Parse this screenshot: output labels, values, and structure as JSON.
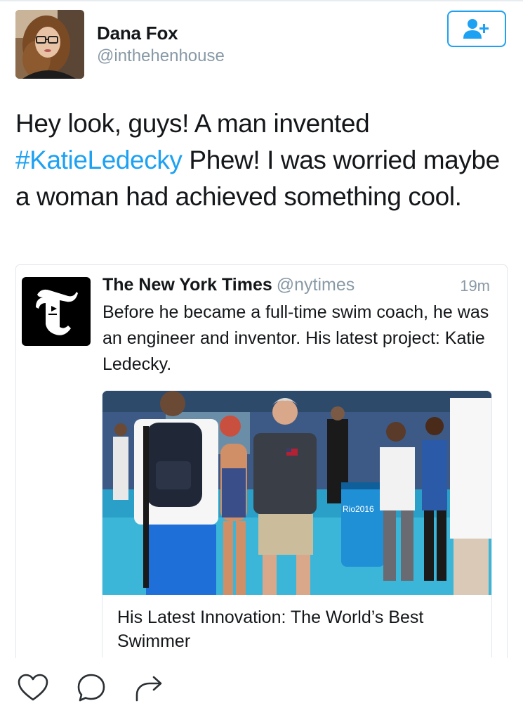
{
  "author": {
    "display_name": "Dana Fox",
    "handle": "@inthehenhouse",
    "avatar_icon": "profile-photo-woman-glasses"
  },
  "follow_button": {
    "icon": "follow-user-plus-icon",
    "accent_color": "#1da1f2"
  },
  "tweet": {
    "text_before": "Hey look, guys! A man invented ",
    "hashtag": "#KatieLedecky",
    "text_after": " Phew! I was worried maybe a woman had achieved something cool."
  },
  "quoted_tweet": {
    "author_name": "The New York Times",
    "author_handle": "@nytimes",
    "time": "19m",
    "logo_icon": "nyt-t-logo",
    "text": "Before he became a full-time swim coach, he was an engineer and inventor. His latest project: Katie Ledecky.",
    "link_card": {
      "image_icon": "photo-pool-deck-rio-2016",
      "photo_text": "Rio2016",
      "title": "His Latest Innovation: The World’s Best Swimmer"
    }
  },
  "actions": [
    {
      "icon": "like-heart-icon"
    },
    {
      "icon": "reply-bubble-icon"
    },
    {
      "icon": "share-arrow-icon"
    }
  ],
  "colors": {
    "link": "#1da1f2",
    "secondary_text": "#8899a6",
    "primary_text": "#14171a"
  }
}
